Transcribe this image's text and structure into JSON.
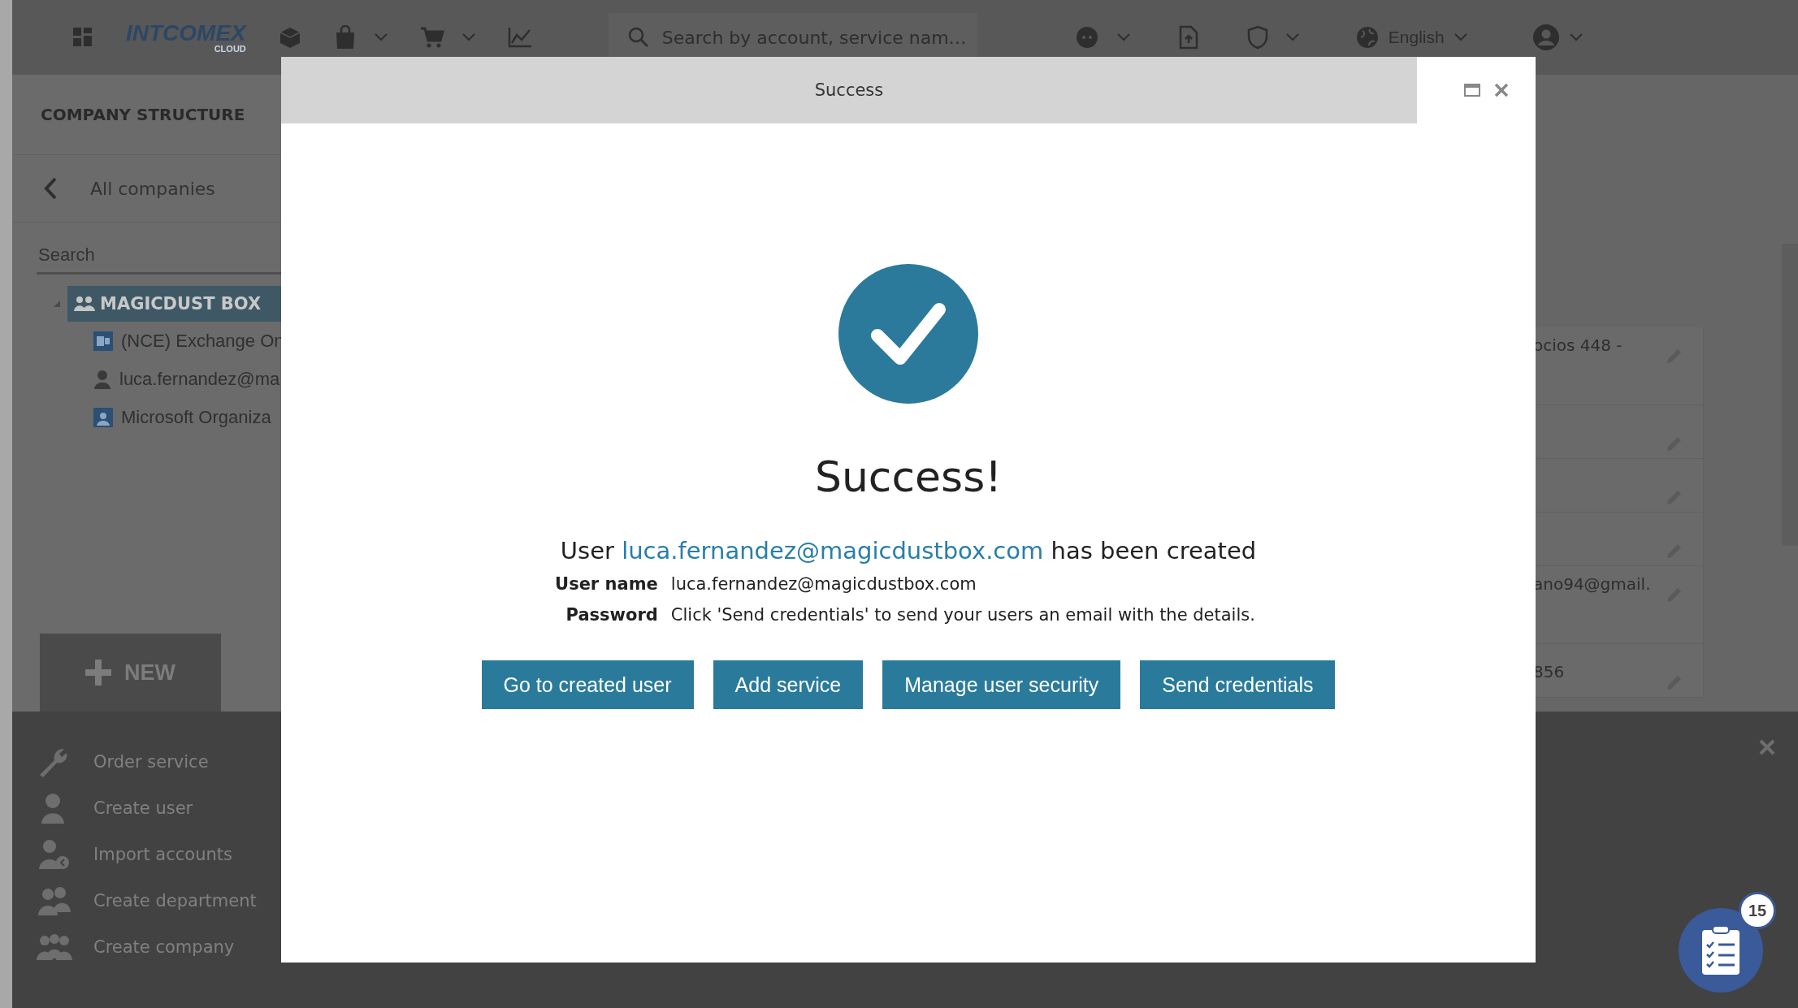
{
  "top_bar": {
    "logo": {
      "name": "INTCOMEX",
      "sub": "CLOUD"
    },
    "search": {
      "placeholder": "Search by account, service nam…"
    },
    "language": "English"
  },
  "sidebar": {
    "title": "COMPANY STRUCTURE",
    "back": "All companies",
    "search": {
      "placeholder": "Search"
    },
    "tree": [
      {
        "label": "MAGICDUST BOX",
        "kind": "company",
        "selected": true,
        "expanded": true,
        "children": [
          {
            "label": "(NCE) Exchange On",
            "kind": "service",
            "selected": false
          },
          {
            "label": "luca.fernandez@ma",
            "kind": "user",
            "selected": false
          },
          {
            "label": "Microsoft Organiza",
            "kind": "organization",
            "selected": false
          }
        ]
      }
    ]
  },
  "new_menu": {
    "button": "NEW",
    "items": [
      {
        "label": "Order service",
        "kind": "wrench"
      },
      {
        "label": "Create user",
        "kind": "user"
      },
      {
        "label": "Import accounts",
        "kind": "import"
      },
      {
        "label": "Create department",
        "kind": "group"
      },
      {
        "label": "Create company",
        "kind": "company"
      }
    ]
  },
  "table": {
    "rows": [
      {
        "cell": "ocios 448 -",
        "editable": true
      },
      {
        "editable": true
      },
      {
        "editable": true
      },
      {
        "editable": true
      },
      {
        "cell": "ano94@gmail.",
        "editable": true
      },
      {
        "cell": "856",
        "editable": true
      }
    ]
  },
  "dialog": {
    "title": "Success",
    "heading": "Success!",
    "message": {
      "before": "User",
      "email": "luca.fernandez@magicdustbox.com",
      "after": "has been created"
    },
    "details": [
      {
        "label": "User name",
        "value": "luca.fernandez@magicdustbox.com"
      },
      {
        "label": "Password",
        "value": "Click 'Send credentials' to send your users an email with the details."
      }
    ],
    "buttons": [
      "Go to created user",
      "Add service",
      "Manage user security",
      "Send credentials"
    ]
  },
  "tasks_badge": {
    "count": "15"
  }
}
